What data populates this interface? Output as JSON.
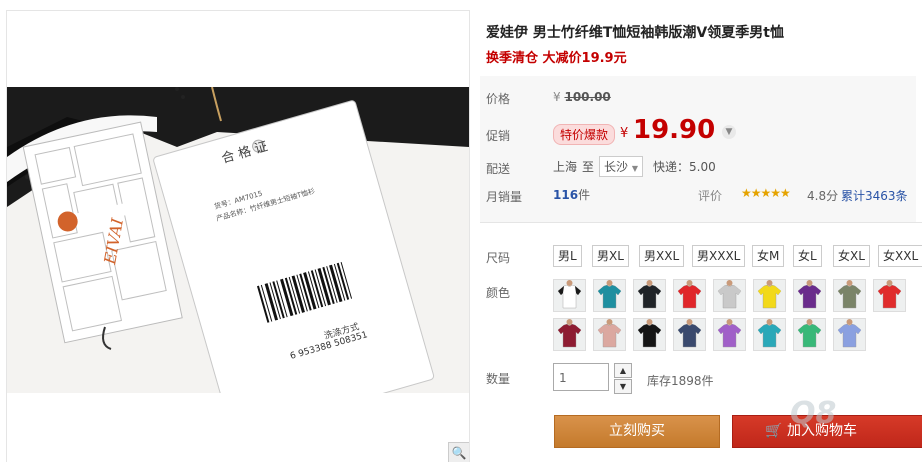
{
  "product": {
    "title": "爱娃伊 男士竹纤维T恤短袖韩版潮V领夏季男t恤",
    "promo": "换季清仓 大减价19.9元"
  },
  "gallery": {
    "zoom_icon": "magnifier-icon",
    "tag": {
      "certificate_title": "合 格 证",
      "brand": "EIVAI",
      "item_no": "货号：AM7015",
      "product_name": "产品名称：竹纤维男士短袖T恤衫",
      "barcode_number": "6 953388 508351",
      "wash_title": "洗涤方式"
    }
  },
  "labels": {
    "price": "价格",
    "promo_price": "促销",
    "delivery": "配送",
    "monthly_sales": "月销量",
    "rating": "评价",
    "size": "尺码",
    "color": "颜色",
    "quantity": "数量"
  },
  "price": {
    "currency": "¥",
    "original": "100.00",
    "badge": "特价爆款",
    "current": "19.90"
  },
  "delivery": {
    "from": "上海",
    "to_word": "至",
    "destination": "长沙",
    "shipping": "快递：5.00"
  },
  "sales": {
    "count": "116",
    "unit": "件",
    "stars": "★★★★★",
    "score": "4.8分",
    "reviews": "累计3463条"
  },
  "sizes": [
    "男L",
    "男XL",
    "男XXL",
    "男XXXL",
    "女M",
    "女L",
    "女XL",
    "女XXL"
  ],
  "colors": [
    {
      "body": "#ffffff",
      "sleeve": "#1a1a1a"
    },
    {
      "body": "#1e8fa0",
      "sleeve": "#1e8fa0"
    },
    {
      "body": "#202428",
      "sleeve": "#202428"
    },
    {
      "body": "#e0262a",
      "sleeve": "#e0262a"
    },
    {
      "body": "#c9c9c9",
      "sleeve": "#c9c9c9"
    },
    {
      "body": "#f2d91a",
      "sleeve": "#f2d91a"
    },
    {
      "body": "#6a2c8c",
      "sleeve": "#6a2c8c"
    },
    {
      "body": "#7a8468",
      "sleeve": "#7a8468"
    },
    {
      "body": "#e02c2c",
      "sleeve": "#e02c2c"
    },
    {
      "body": "#8e1c32",
      "sleeve": "#8e1c32"
    },
    {
      "body": "#dba8a0",
      "sleeve": "#dba8a0"
    },
    {
      "body": "#151515",
      "sleeve": "#151515"
    },
    {
      "body": "#3a4a6e",
      "sleeve": "#3a4a6e"
    },
    {
      "body": "#a060c8",
      "sleeve": "#a060c8"
    },
    {
      "body": "#2aa8b8",
      "sleeve": "#2aa8b8"
    },
    {
      "body": "#38b878",
      "sleeve": "#38b878"
    },
    {
      "body": "#8aa0e0",
      "sleeve": "#8aa0e0"
    }
  ],
  "quantity": {
    "value": "1",
    "stock": "库存1898件"
  },
  "buttons": {
    "buy_now": "立刻购买",
    "add_to_cart": "加入购物车",
    "cart_icon": "cart-icon"
  },
  "watermark": "Q8"
}
